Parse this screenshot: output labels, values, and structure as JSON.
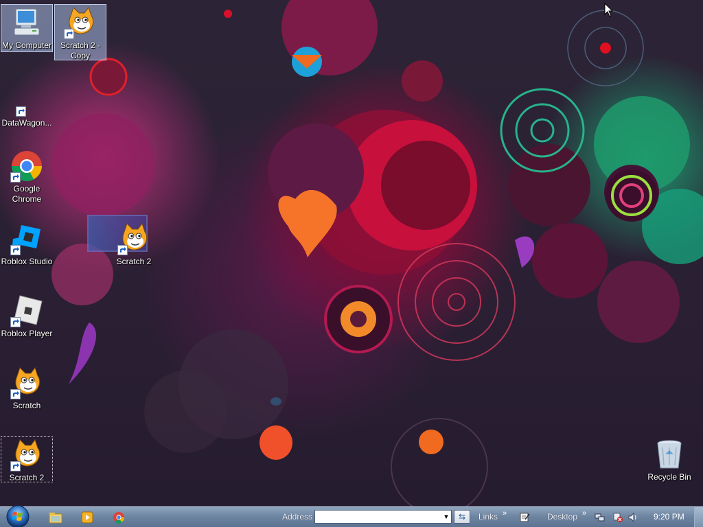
{
  "desktop": {
    "icons": [
      {
        "name": "my-computer",
        "label": "My Computer",
        "icon": "computer-icon"
      },
      {
        "name": "scratch-2-copy",
        "label": "Scratch 2 - Copy",
        "icon": "scratch-cat-icon"
      },
      {
        "name": "datawagon",
        "label": "DataWagon...",
        "icon": "shortcut-icon"
      },
      {
        "name": "google-chrome",
        "label": "Google Chrome",
        "icon": "chrome-icon"
      },
      {
        "name": "roblox-studio",
        "label": "Roblox Studio",
        "icon": "roblox-studio-icon"
      },
      {
        "name": "scratch-2-middle",
        "label": "Scratch 2",
        "icon": "scratch-cat-icon"
      },
      {
        "name": "roblox-player",
        "label": "Roblox Player",
        "icon": "roblox-player-icon"
      },
      {
        "name": "scratch",
        "label": "Scratch",
        "icon": "scratch-cat-icon"
      },
      {
        "name": "scratch-2-bottom",
        "label": "Scratch 2",
        "icon": "scratch-cat-icon"
      },
      {
        "name": "recycle-bin",
        "label": "Recycle Bin",
        "icon": "recycle-bin-icon"
      }
    ]
  },
  "taskbar": {
    "quick_launch": [
      "explorer-icon",
      "media-player-icon",
      "chrome-icon"
    ],
    "address_label": "Address",
    "address_value": "",
    "links_label": "Links",
    "desktop_label": "Desktop",
    "clock": "9:20 PM"
  },
  "colors": {
    "taskbar": "#6f86a3",
    "start_orb": "#2b6fbf",
    "wallpaper_base": "#2a2036",
    "selection": "#a8bce4"
  }
}
